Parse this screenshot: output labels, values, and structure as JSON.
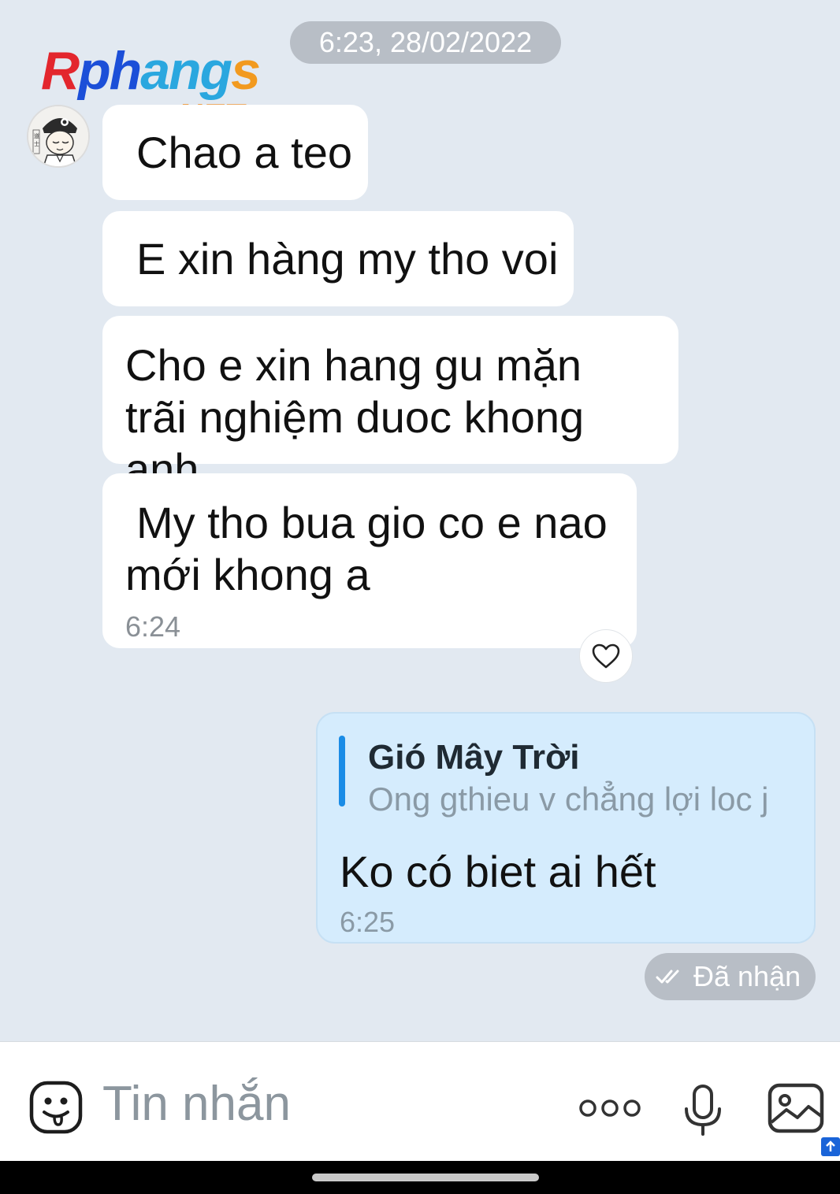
{
  "header": {
    "timestamp": "6:23, 28/02/2022"
  },
  "watermark": {
    "logo_main": "Rphangs",
    "logo_suffix": ".NET"
  },
  "messages": {
    "incoming": [
      {
        "text": "Chao a teo"
      },
      {
        "text": "E xin hàng my tho voi"
      },
      {
        "text": "Cho e xin hang gu mặn trãi nghiệm duoc khong anh"
      },
      {
        "text": "My tho bua gio co e nao mới khong a",
        "time": "6:24"
      }
    ],
    "outgoing": {
      "quote": {
        "author": "Gió Mây Trời",
        "text": "Ong gthieu v chẳng lợi loc j"
      },
      "text": "Ko có biet ai hết",
      "time": "6:25"
    },
    "status": "Đã nhận"
  },
  "input_bar": {
    "placeholder": "Tin nhắn",
    "icons": [
      "emoji-icon",
      "more-icon",
      "microphone-icon",
      "image-icon"
    ]
  },
  "colors": {
    "chat_background": "#e2e9f1",
    "incoming_bubble": "#ffffff",
    "outgoing_bubble": "#d5ecfd",
    "quote_bar": "#1a8ce6",
    "pill": "#b8bec6"
  }
}
